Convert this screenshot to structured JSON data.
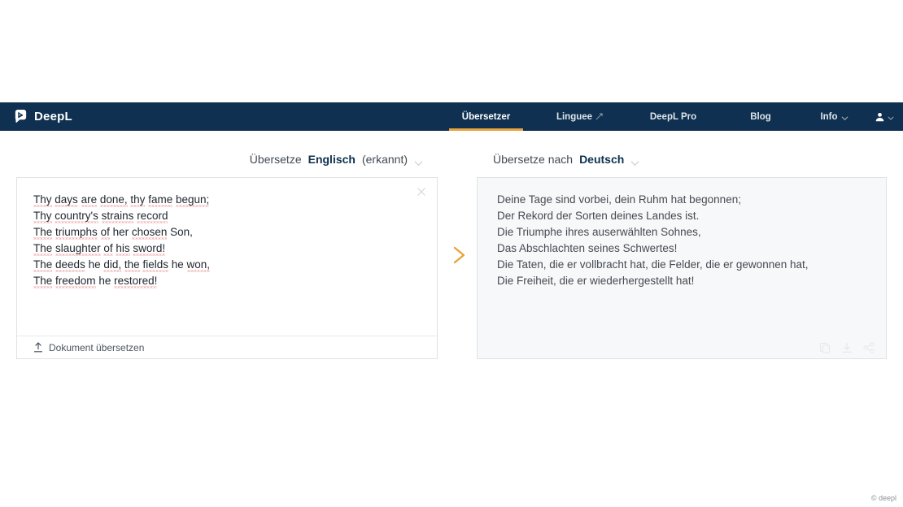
{
  "header": {
    "brand": "DeepL",
    "brand_icon": "deepl-logo-icon",
    "nav": [
      {
        "label": "Übersetzer",
        "active": true,
        "icon": null
      },
      {
        "label": "Linguee",
        "active": false,
        "icon": "external-link-icon"
      },
      {
        "label": "DeepL Pro",
        "active": false,
        "icon": null
      },
      {
        "label": "Blog",
        "active": false,
        "icon": null
      },
      {
        "label": "Info",
        "active": false,
        "icon": "chevron-down-icon"
      }
    ],
    "account_icon": "person-icon",
    "account_chevron": "chevron-down-icon"
  },
  "language_bar": {
    "source_prefix": "Übersetze",
    "source_language": "Englisch",
    "source_suffix": "(erkannt)",
    "target_prefix": "Übersetze nach",
    "target_language": "Deutsch",
    "chevron_icon": "chevron-down-icon"
  },
  "source_panel": {
    "lines": [
      [
        {
          "t": "Thy",
          "sq": true
        },
        {
          "t": " ",
          "sq": false
        },
        {
          "t": "days",
          "sq": true
        },
        {
          "t": " ",
          "sq": false
        },
        {
          "t": "are",
          "sq": true
        },
        {
          "t": " ",
          "sq": false
        },
        {
          "t": "done,",
          "sq": true
        },
        {
          "t": " ",
          "sq": false
        },
        {
          "t": "thy",
          "sq": true
        },
        {
          "t": " ",
          "sq": false
        },
        {
          "t": "fame",
          "sq": true
        },
        {
          "t": " ",
          "sq": false
        },
        {
          "t": "begun;",
          "sq": true
        }
      ],
      [
        {
          "t": "Thy",
          "sq": true
        },
        {
          "t": " ",
          "sq": false
        },
        {
          "t": "country's",
          "sq": true
        },
        {
          "t": " ",
          "sq": false
        },
        {
          "t": "strains",
          "sq": true
        },
        {
          "t": " ",
          "sq": false
        },
        {
          "t": "record",
          "sq": true
        }
      ],
      [
        {
          "t": "The",
          "sq": true
        },
        {
          "t": " ",
          "sq": false
        },
        {
          "t": "triumphs",
          "sq": true
        },
        {
          "t": " ",
          "sq": false
        },
        {
          "t": "of",
          "sq": true
        },
        {
          "t": " her ",
          "sq": false
        },
        {
          "t": "chosen",
          "sq": true
        },
        {
          "t": " Son,",
          "sq": false
        }
      ],
      [
        {
          "t": "The",
          "sq": true
        },
        {
          "t": " ",
          "sq": false
        },
        {
          "t": "slaughter",
          "sq": true
        },
        {
          "t": " ",
          "sq": false
        },
        {
          "t": "of",
          "sq": true
        },
        {
          "t": " ",
          "sq": false
        },
        {
          "t": "his",
          "sq": true
        },
        {
          "t": " ",
          "sq": false
        },
        {
          "t": "sword!",
          "sq": true
        }
      ],
      [
        {
          "t": "The",
          "sq": true
        },
        {
          "t": " ",
          "sq": false
        },
        {
          "t": "deeds",
          "sq": true
        },
        {
          "t": " he ",
          "sq": false
        },
        {
          "t": "did,",
          "sq": true
        },
        {
          "t": " ",
          "sq": false
        },
        {
          "t": "the",
          "sq": true
        },
        {
          "t": " ",
          "sq": false
        },
        {
          "t": "fields",
          "sq": true
        },
        {
          "t": " he ",
          "sq": false
        },
        {
          "t": "won,",
          "sq": true
        }
      ],
      [
        {
          "t": "The",
          "sq": true
        },
        {
          "t": " ",
          "sq": false
        },
        {
          "t": "freedom",
          "sq": true
        },
        {
          "t": " he ",
          "sq": false
        },
        {
          "t": "restored!",
          "sq": true
        }
      ]
    ],
    "clear_icon": "close-icon",
    "footer_label": "Dokument übersetzen",
    "footer_icon": "upload-icon"
  },
  "target_panel": {
    "lines": [
      "Deine Tage sind vorbei, dein Ruhm hat begonnen;",
      "Der Rekord der Sorten deines Landes ist.",
      "Die Triumphe ihres auserwählten Sohnes,",
      "Das Abschlachten seines Schwertes!",
      "Die Taten, die er vollbracht hat, die Felder, die er gewonnen hat,",
      "Die Freiheit, die er wiederhergestellt hat!"
    ],
    "actions": [
      {
        "icon": "copy-icon"
      },
      {
        "icon": "download-icon"
      },
      {
        "icon": "share-icon"
      }
    ]
  },
  "swap_arrow_icon": "chevron-right-icon",
  "footer_credit": "© deepl",
  "colors": {
    "header_bg": "#0f3050",
    "accent": "#e8a33d",
    "spellcheck": "#e8706f",
    "panel_border": "#dfe3e6",
    "target_bg": "#f7f8f9"
  }
}
